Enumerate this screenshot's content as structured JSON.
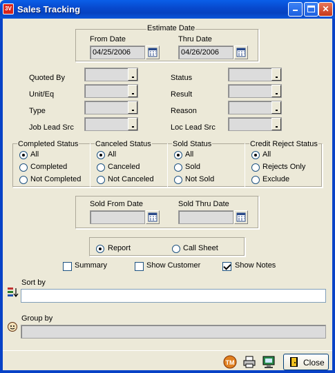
{
  "window": {
    "title": "Sales Tracking",
    "app_icon_text": "3V"
  },
  "estimate_date": {
    "legend": "Estimate Date",
    "from_label": "From Date",
    "from_value": "04/25/2006",
    "thru_label": "Thru Date",
    "thru_value": "04/26/2006"
  },
  "filters_left": [
    {
      "label": "Quoted By",
      "value": ""
    },
    {
      "label": "Unit/Eq",
      "value": ""
    },
    {
      "label": "Type",
      "value": ""
    },
    {
      "label": "Job Lead Src",
      "value": ""
    }
  ],
  "filters_right": [
    {
      "label": "Status",
      "value": ""
    },
    {
      "label": "Result",
      "value": ""
    },
    {
      "label": "Reason",
      "value": ""
    },
    {
      "label": "Loc Lead Src",
      "value": ""
    }
  ],
  "status_groups": [
    {
      "legend": "Completed Status",
      "options": [
        "All",
        "Completed",
        "Not Completed"
      ],
      "selected": 0
    },
    {
      "legend": "Canceled Status",
      "options": [
        "All",
        "Canceled",
        "Not Canceled"
      ],
      "selected": 0
    },
    {
      "legend": "Sold Status",
      "options": [
        "All",
        "Sold",
        "Not Sold"
      ],
      "selected": 0
    },
    {
      "legend": "Credit Reject Status",
      "options": [
        "All",
        "Rejects Only",
        "Exclude"
      ],
      "selected": 0
    }
  ],
  "sold_date": {
    "from_label": "Sold From Date",
    "from_value": "",
    "thru_label": "Sold Thru Date",
    "thru_value": ""
  },
  "output_type": {
    "options": [
      "Report",
      "Call Sheet"
    ],
    "selected": 0
  },
  "checkboxes": [
    {
      "label": "Summary",
      "checked": false
    },
    {
      "label": "Show Customer",
      "checked": false
    },
    {
      "label": "Show Notes",
      "checked": true
    }
  ],
  "sort_by": {
    "label": "Sort by",
    "value": ""
  },
  "group_by": {
    "label": "Group by",
    "value": ""
  },
  "toolbar": {
    "close_label": "Close"
  },
  "colors": {
    "titlebar": "#0a5fe8",
    "background": "#ece9d8",
    "frame": "#0842c7"
  }
}
